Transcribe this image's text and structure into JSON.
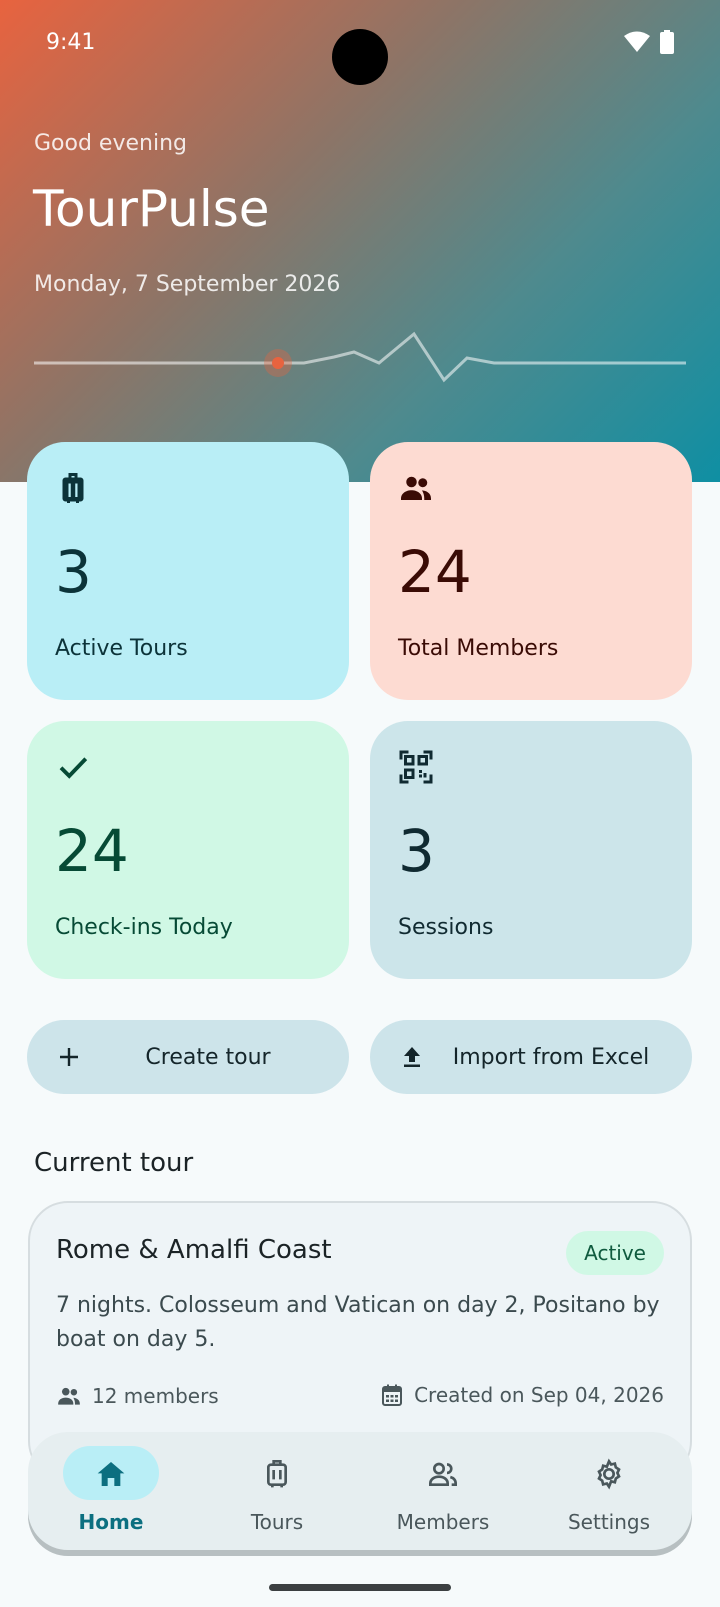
{
  "status": {
    "time": "9:41"
  },
  "header": {
    "greeting": "Good evening",
    "app_title": "TourPulse",
    "date": "Monday, 7 September 2026"
  },
  "stats": [
    {
      "icon": "luggage-icon",
      "value": "3",
      "label": "Active Tours"
    },
    {
      "icon": "group-icon",
      "value": "24",
      "label": "Total Members"
    },
    {
      "icon": "check-icon",
      "value": "24",
      "label": "Check-ins Today"
    },
    {
      "icon": "qr-code-icon",
      "value": "3",
      "label": "Sessions"
    }
  ],
  "actions": {
    "create_label": "Create tour",
    "import_label": "Import from Excel"
  },
  "current_tour": {
    "section_title": "Current tour",
    "name": "Rome & Amalfi Coast",
    "status": "Active",
    "description": "7 nights. Colosseum and Vatican on day 2, Positano by boat on day 5.",
    "members": "12 members",
    "created": "Created on Sep 04, 2026"
  },
  "nav": [
    {
      "icon": "home-icon",
      "label": "Home",
      "active": true
    },
    {
      "icon": "luggage-icon",
      "label": "Tours",
      "active": false
    },
    {
      "icon": "members-icon",
      "label": "Members",
      "active": false
    },
    {
      "icon": "settings-icon",
      "label": "Settings",
      "active": false
    }
  ],
  "colors": {
    "accent": "#0c6f80",
    "active_tours_card": "#b9eef6",
    "members_card": "#fddbd2",
    "checkins_card": "#d0f8e5",
    "sessions_card": "#cce5ea"
  }
}
